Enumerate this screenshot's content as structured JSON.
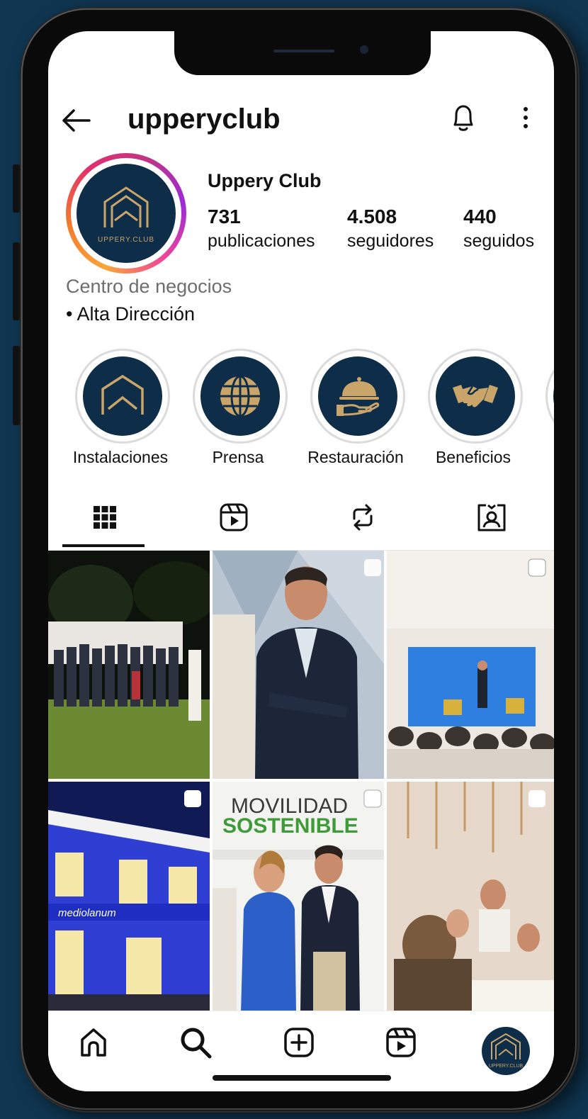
{
  "header": {
    "username": "upperyclub"
  },
  "profile": {
    "display_name": "Uppery Club",
    "avatar_brand": "UPPERY.CLUB",
    "stats": [
      {
        "value": "731",
        "label": "publicaciones"
      },
      {
        "value": "4.508",
        "label": "seguidores"
      },
      {
        "value": "440",
        "label": "seguidos"
      }
    ],
    "bio_category": "Centro de negocios",
    "bio_line": "• Alta Dirección"
  },
  "highlights": [
    {
      "label": "Instalaciones",
      "icon": "house-logo-icon"
    },
    {
      "label": "Prensa",
      "icon": "globe-icon"
    },
    {
      "label": "Restauración",
      "icon": "cloche-icon"
    },
    {
      "label": "Beneficios",
      "icon": "handshake-icon"
    }
  ],
  "tabs": [
    "grid-icon",
    "reels-icon",
    "reposts-icon",
    "tagged-icon"
  ],
  "grid": {
    "tile_5_text_line1": "MOVILIDAD",
    "tile_5_text_line2": "SOSTENIBLE",
    "tile_4_sign": "mediolanum"
  },
  "nav": {
    "items": [
      "home-icon",
      "search-icon",
      "create-icon",
      "reels-icon",
      "profile-avatar"
    ],
    "avatar_brand": "UPPERY.CLUB"
  },
  "colors": {
    "brand_navy": "#0e2d48",
    "brand_gold": "#c9a56a",
    "background": "#0f3550"
  }
}
